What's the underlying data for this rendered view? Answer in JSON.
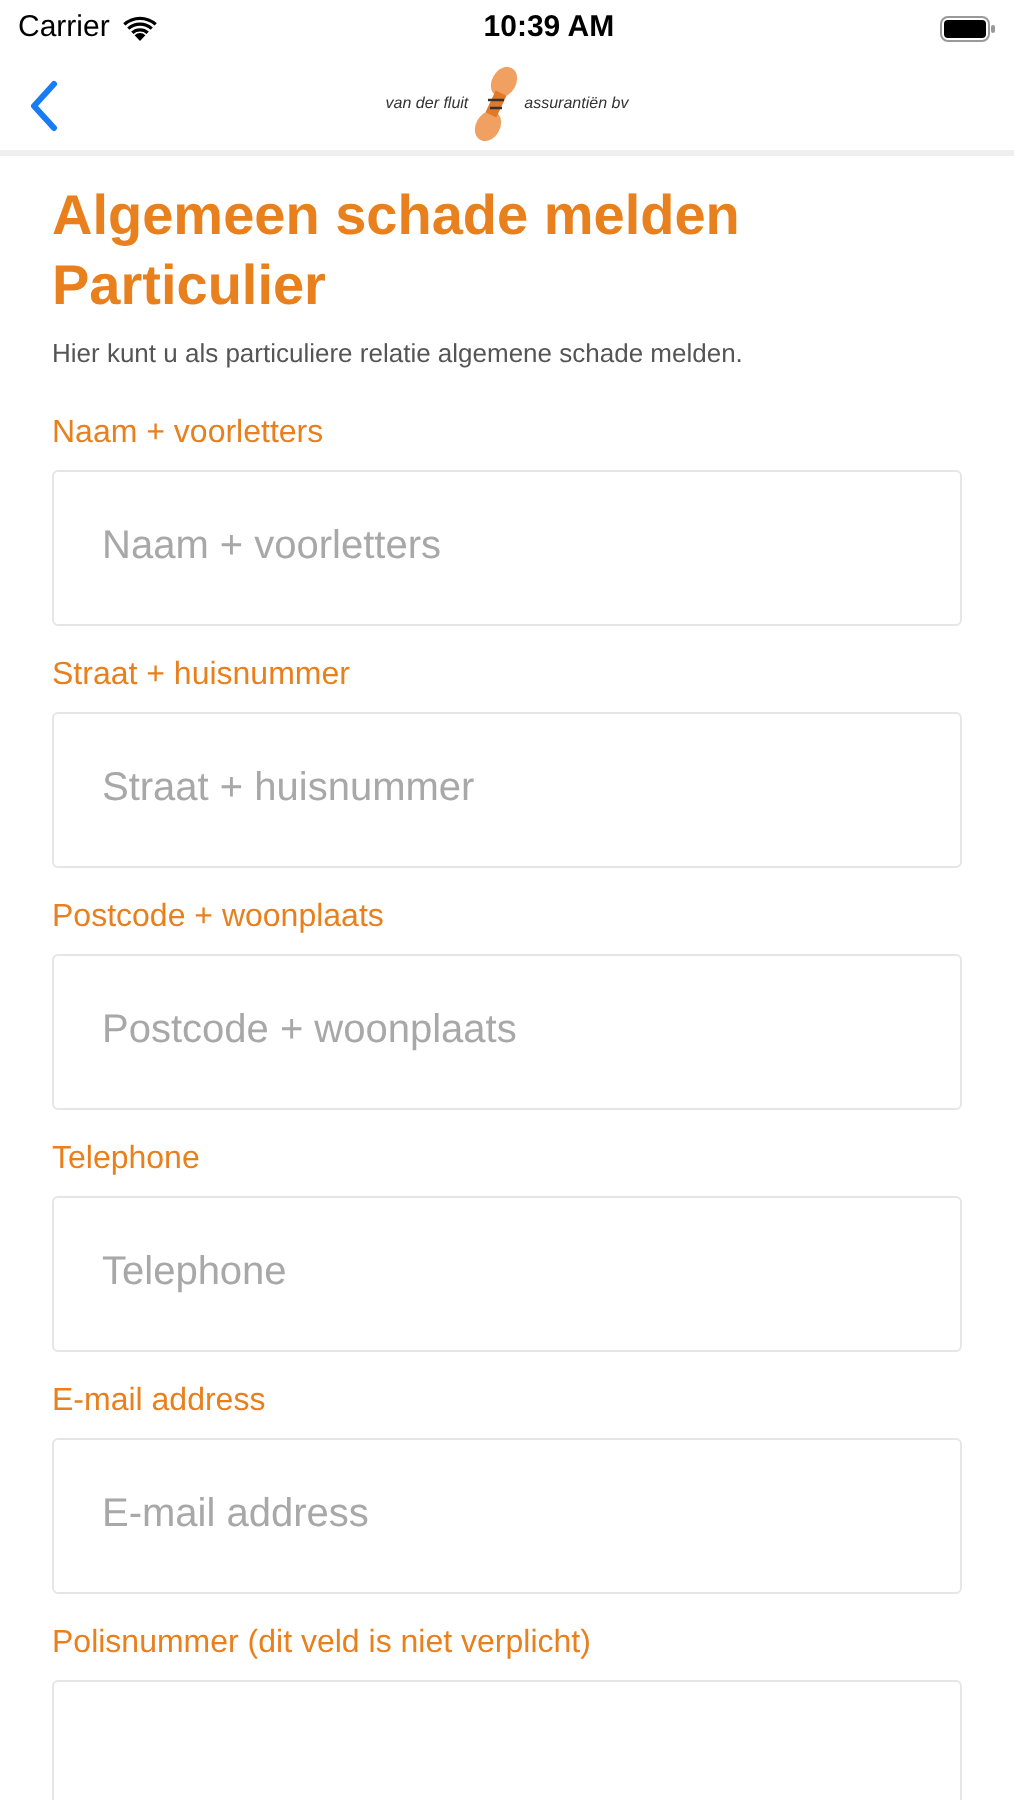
{
  "status_bar": {
    "carrier": "Carrier",
    "time": "10:39 AM"
  },
  "nav": {
    "logo_left": "van der fluit",
    "logo_right": "assurantiën bv"
  },
  "title": "Algemeen schade melden Particulier",
  "intro": "Hier kunt u als particuliere relatie algemene schade melden.",
  "fields": [
    {
      "label": "Naam + voorletters",
      "placeholder": "Naam + voorletters"
    },
    {
      "label": "Straat + huisnummer",
      "placeholder": "Straat + huisnummer"
    },
    {
      "label": "Postcode + woonplaats",
      "placeholder": "Postcode + woonplaats"
    },
    {
      "label": "Telephone",
      "placeholder": "Telephone"
    },
    {
      "label": "E-mail address",
      "placeholder": "E-mail address"
    },
    {
      "label": "Polisnummer (dit veld is niet verplicht)"
    }
  ]
}
